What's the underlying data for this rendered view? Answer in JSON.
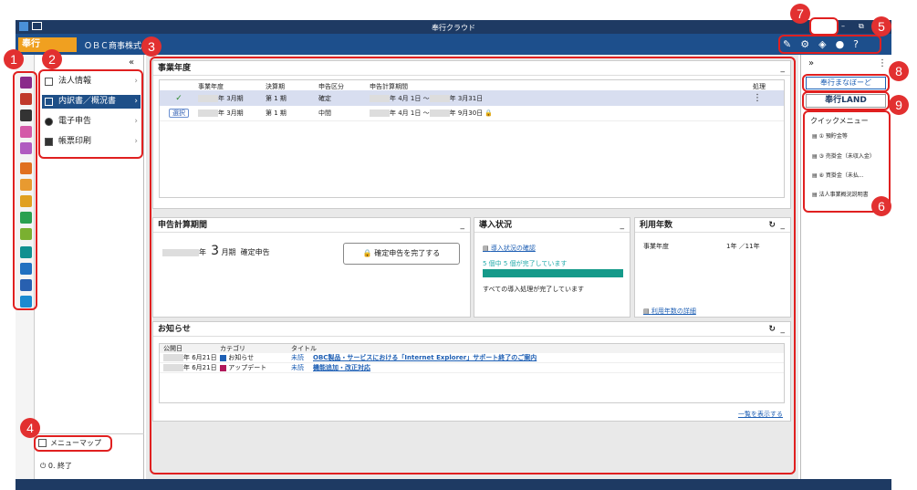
{
  "window": {
    "title": "奉行クラウド"
  },
  "app": {
    "logo_text": "奉行",
    "company_name": "ＯＢＣ商事株式"
  },
  "left_menu": {
    "items": [
      {
        "label": "法人情報"
      },
      {
        "label": "内訳書／概況書"
      },
      {
        "label": "電子申告"
      },
      {
        "label": "帳票印刷"
      }
    ],
    "collapse_label": "«",
    "map_label": "メニューマップ",
    "exit_label": "0. 終了"
  },
  "fiscal": {
    "title": "事業年度",
    "min": "_",
    "headers": [
      "事業年度",
      "決算期",
      "申告区分",
      "申告計算期間",
      "処理"
    ],
    "rows": [
      {
        "action": "✓",
        "year": "年  3月期",
        "period": "第 1 期",
        "type": "確定",
        "range_from": "年  4月 1日 〜",
        "range_to": "年  3月31日",
        "lock": ""
      },
      {
        "action": "選択",
        "year": "年  3月期",
        "period": "第 1 期",
        "type": "中間",
        "range_from": "年  4月 1日 〜",
        "range_to": "年  9月30日",
        "lock": "🔒"
      }
    ]
  },
  "calc": {
    "title": "申告計算期間",
    "min": "_",
    "year_suffix": "年",
    "period_num": "3",
    "period_unit": "月期",
    "kind": "確定申告",
    "complete_button": "確定申告を完了する"
  },
  "intro": {
    "title": "導入状況",
    "min": "_",
    "link": "導入状況の確認",
    "progress_text": "5 個中 5 個が完了しています",
    "progress": 1.0,
    "done_text": "すべての導入処理が完了しています"
  },
  "usage": {
    "title": "利用年数",
    "min": "_",
    "refresh": "↻",
    "label": "事業年度",
    "value": "1年 ／11年",
    "link": "利用年数の詳細"
  },
  "news": {
    "title": "お知らせ",
    "min": "_",
    "refresh": "↻",
    "headers": [
      "公開日",
      "カテゴリ",
      "タイトル"
    ],
    "rows": [
      {
        "date": "年  6月21日",
        "category": "お知らせ",
        "cat_color": "#1e5fb4",
        "status": "未読",
        "title": "OBC製品・サービスにおける「Internet Explorer」サポート終了のご案内"
      },
      {
        "date": "年  6月21日",
        "category": "アップデート",
        "cat_color": "#b0185a",
        "status": "未読",
        "title": "機能追加・改正対応"
      }
    ],
    "more_link": "一覧を表示する"
  },
  "right": {
    "collapse": "»",
    "menu_dots": "⋮",
    "manabi": "奉行まなぼーど",
    "land": "奉行LAND",
    "quick_title": "クイックメニュー",
    "quick_items": [
      {
        "label": "① 預貯金等"
      },
      {
        "label": "③ 売掛金（未収入金）"
      },
      {
        "label": "⑧ 買掛金（未払..."
      },
      {
        "label": "法人事業概況説明書"
      }
    ]
  },
  "callouts": [
    "1",
    "2",
    "3",
    "4",
    "5",
    "6",
    "7",
    "8",
    "9"
  ]
}
